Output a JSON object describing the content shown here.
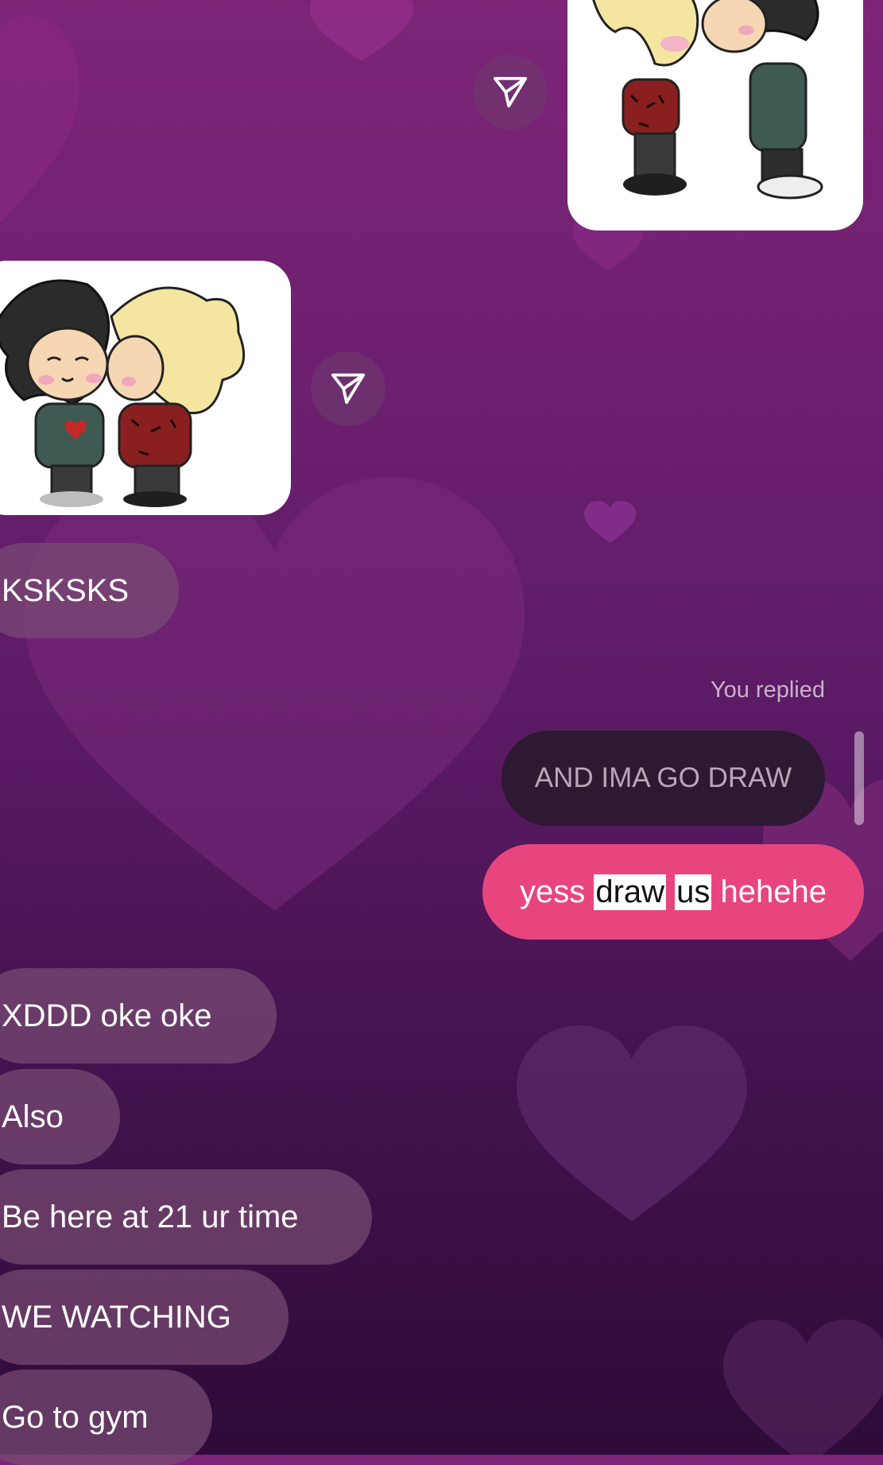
{
  "theme": {
    "incoming_bubble": "#7a4b75",
    "outgoing_bubble": "#e8457e",
    "replied_bubble": "#2e1932",
    "highlight": "#ffffff"
  },
  "stickers": [
    {
      "description_icon": "kissing-couple-sticker",
      "side": "outgoing"
    },
    {
      "description_icon": "kissing-couple-sticker",
      "side": "incoming"
    }
  ],
  "share_icon": "paper-plane-icon",
  "messages": {
    "ksksks": "KSKSKS",
    "reply_label": "You replied",
    "replied_to": "AND IMA GO DRAW",
    "reply": {
      "part1": "yess ",
      "word1": "draw",
      "word2": "us",
      "part2": " hehehe"
    },
    "m1": "XDDD oke oke",
    "m2": "Also",
    "m3": "Be here at 21 ur time",
    "m4": "WE WATCHING",
    "m5": "Go to gym"
  }
}
